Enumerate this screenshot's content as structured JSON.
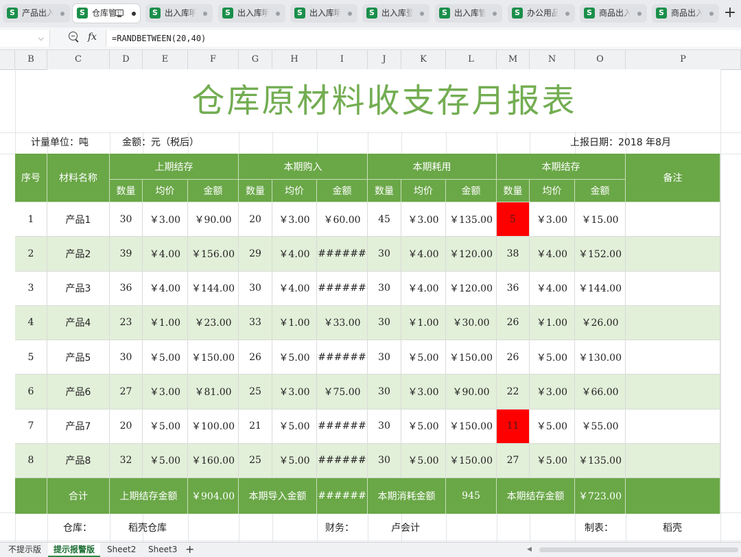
{
  "tabs": [
    {
      "label": "产品出入库",
      "active": false
    },
    {
      "label": "仓库管理",
      "active": true
    },
    {
      "label": "出入库明细",
      "active": false
    },
    {
      "label": "出入库明细",
      "active": false
    },
    {
      "label": "出入库明细",
      "active": false
    },
    {
      "label": "出入库登记",
      "active": false
    },
    {
      "label": "出入库管理",
      "active": false
    },
    {
      "label": "办公用品出入",
      "active": false
    },
    {
      "label": "商品出入库",
      "active": false
    },
    {
      "label": "商品出入库",
      "active": false
    }
  ],
  "formula_bar": {
    "formula": "=RANDBETWEEN(20,40)"
  },
  "columns": [
    "B",
    "C",
    "D",
    "E",
    "F",
    "G",
    "H",
    "I",
    "J",
    "K",
    "L",
    "M",
    "N",
    "O",
    "P"
  ],
  "report": {
    "title": "仓库原材料收支存月报表",
    "unit_label": "计量单位：吨",
    "amount_label": "金额：元（税后）",
    "date_label": "上报日期：2018 年8月"
  },
  "table": {
    "group_headers": {
      "index": "序号",
      "name": "材料名称",
      "opening": "上期结存",
      "purchase": "本期购入",
      "consume": "本期耗用",
      "closing": "本期结存",
      "remark": "备注"
    },
    "sub_headers": [
      "数量",
      "均价",
      "金额",
      "数量",
      "均价",
      "金额",
      "数量",
      "均价",
      "金额",
      "数量",
      "均价",
      "金额"
    ],
    "rows": [
      {
        "idx": "1",
        "name": "产品1",
        "v": [
          "30",
          "￥3.00",
          "￥90.00",
          "20",
          "￥3.00",
          "￥60.00",
          "45",
          "￥3.00",
          "￥135.00",
          "5",
          "￥3.00",
          "￥15.00"
        ],
        "alert": true
      },
      {
        "idx": "2",
        "name": "产品2",
        "v": [
          "39",
          "￥4.00",
          "￥156.00",
          "29",
          "￥4.00",
          "########",
          "30",
          "￥4.00",
          "￥120.00",
          "38",
          "￥4.00",
          "￥152.00"
        ],
        "alert": false
      },
      {
        "idx": "3",
        "name": "产品3",
        "v": [
          "36",
          "￥4.00",
          "￥144.00",
          "30",
          "￥4.00",
          "########",
          "30",
          "￥4.00",
          "￥120.00",
          "36",
          "￥4.00",
          "￥144.00"
        ],
        "alert": false
      },
      {
        "idx": "4",
        "name": "产品4",
        "v": [
          "23",
          "￥1.00",
          "￥23.00",
          "33",
          "￥1.00",
          "￥33.00",
          "30",
          "￥1.00",
          "￥30.00",
          "26",
          "￥1.00",
          "￥26.00"
        ],
        "alert": false
      },
      {
        "idx": "5",
        "name": "产品5",
        "v": [
          "30",
          "￥5.00",
          "￥150.00",
          "26",
          "￥5.00",
          "########",
          "30",
          "￥5.00",
          "￥150.00",
          "26",
          "￥5.00",
          "￥130.00"
        ],
        "alert": false
      },
      {
        "idx": "6",
        "name": "产品6",
        "v": [
          "27",
          "￥3.00",
          "￥81.00",
          "25",
          "￥3.00",
          "￥75.00",
          "30",
          "￥3.00",
          "￥90.00",
          "22",
          "￥3.00",
          "￥66.00"
        ],
        "alert": false
      },
      {
        "idx": "7",
        "name": "产品7",
        "v": [
          "20",
          "￥5.00",
          "￥100.00",
          "21",
          "￥5.00",
          "########",
          "30",
          "￥5.00",
          "￥150.00",
          "11",
          "￥5.00",
          "￥55.00"
        ],
        "alert": true
      },
      {
        "idx": "8",
        "name": "产品8",
        "v": [
          "32",
          "￥5.00",
          "￥160.00",
          "25",
          "￥5.00",
          "########",
          "30",
          "￥5.00",
          "￥150.00",
          "27",
          "￥5.00",
          "￥135.00"
        ],
        "alert": false
      }
    ],
    "totals": {
      "label": "合计",
      "opening_label": "上期结存金额",
      "opening_value": "￥904.00",
      "purchase_label": "本期导入金额",
      "purchase_value": "########",
      "consume_label": "本期消耗金额",
      "consume_value": "945",
      "closing_label": "本期结存金额",
      "closing_value": "￥723.00"
    }
  },
  "footer": {
    "warehouse_label": "仓库：",
    "warehouse_value": "稻壳仓库",
    "finance_label": "财务：",
    "finance_value": "卢会计",
    "maker_label": "制表：",
    "maker_value": "稻壳"
  },
  "sheet_tabs": [
    {
      "label": "不提示版",
      "active": false
    },
    {
      "label": "提示报警版",
      "active": true
    },
    {
      "label": "Sheet2",
      "active": false
    },
    {
      "label": "Sheet3",
      "active": false
    }
  ],
  "colors": {
    "header_green": "#6aa747",
    "alt_row": "#e2efd9",
    "title_green": "#73ad52",
    "alert_red": "#ff0000"
  }
}
